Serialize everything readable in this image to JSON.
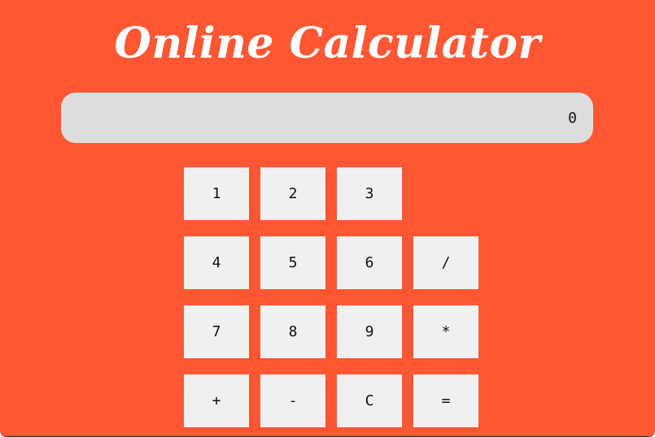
{
  "app": {
    "title": "Online Calculator",
    "colors": {
      "background": "#ff5733",
      "display": "#dddddd",
      "key": "#f0f0f0",
      "title_text": "#ffffff"
    }
  },
  "display": {
    "value": "0"
  },
  "keys": {
    "one": "1",
    "two": "2",
    "three": "3",
    "four": "4",
    "five": "5",
    "six": "6",
    "divide": "/",
    "seven": "7",
    "eight": "8",
    "nine": "9",
    "multiply": "*",
    "plus": "+",
    "minus": "-",
    "clear": "C",
    "equals": "="
  }
}
